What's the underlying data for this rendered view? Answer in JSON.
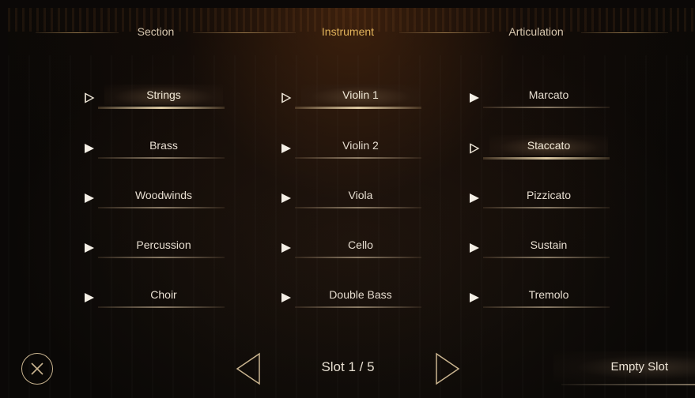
{
  "headers": {
    "section": "Section",
    "instrument": "Instrument",
    "articulation": "Articulation"
  },
  "columns": {
    "section": [
      {
        "label": "Strings",
        "selected": true
      },
      {
        "label": "Brass",
        "selected": false
      },
      {
        "label": "Woodwinds",
        "selected": false
      },
      {
        "label": "Percussion",
        "selected": false
      },
      {
        "label": "Choir",
        "selected": false
      }
    ],
    "instrument": [
      {
        "label": "Violin 1",
        "selected": true
      },
      {
        "label": "Violin 2",
        "selected": false
      },
      {
        "label": "Viola",
        "selected": false
      },
      {
        "label": "Cello",
        "selected": false
      },
      {
        "label": "Double Bass",
        "selected": false
      }
    ],
    "articulation": [
      {
        "label": "Marcato",
        "selected": false
      },
      {
        "label": "Staccato",
        "selected": true
      },
      {
        "label": "Pizzicato",
        "selected": false
      },
      {
        "label": "Sustain",
        "selected": false
      },
      {
        "label": "Tremolo",
        "selected": false
      }
    ]
  },
  "footer": {
    "slot_label": "Slot 1 / 5",
    "empty_slot_label": "Empty Slot",
    "close_icon": "close-circle-icon",
    "prev_icon": "triangle-left-icon",
    "next_icon": "triangle-right-icon"
  },
  "colors": {
    "accent": "#e0b25a",
    "text": "#e6ddd0",
    "outline": "#c9b48f"
  }
}
